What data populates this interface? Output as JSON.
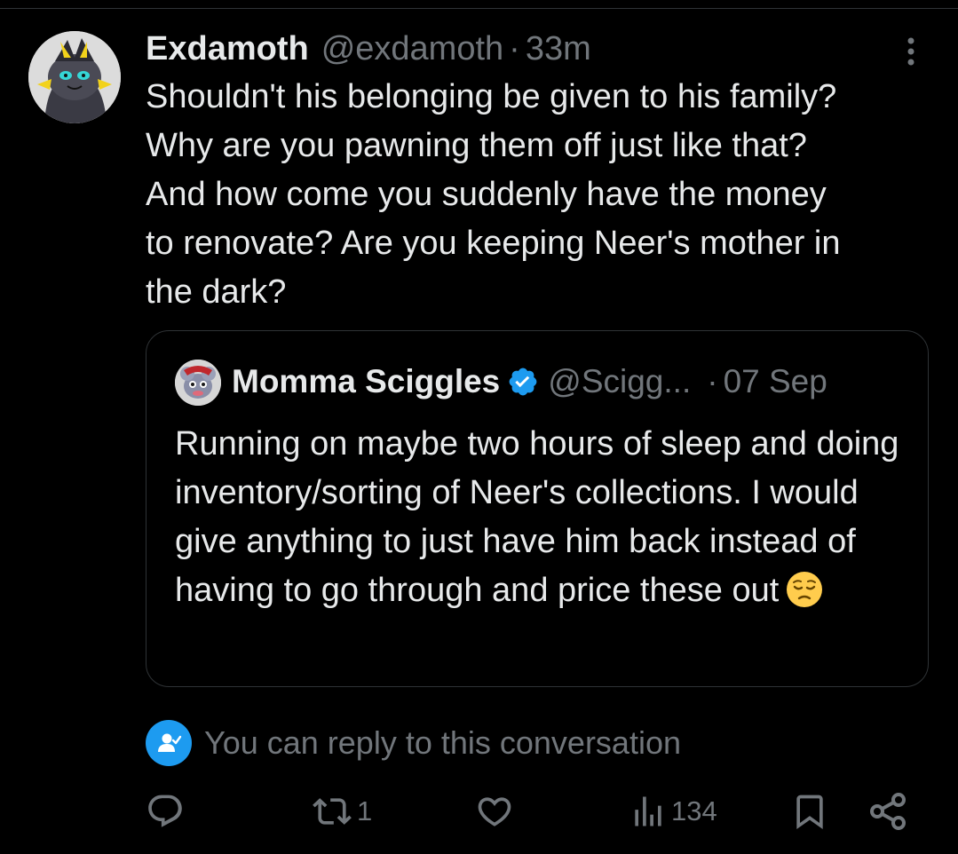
{
  "tweet": {
    "display_name": "Exdamoth",
    "handle": "@exdamoth",
    "separator": "·",
    "time": "33m",
    "text": "Shouldn't his belonging be given to his family?\nWhy are you pawning them off just like that?\nAnd how come you suddenly have the money\nto renovate? Are you keeping Neer's mother in\nthe dark?",
    "avatar_icon": "zeraora-avatar-icon",
    "more_icon": "more-vertical-icon"
  },
  "quote": {
    "display_name": "Momma Sciggles",
    "handle": "@Scigg...",
    "separator": "·",
    "date": "07 Sep",
    "text": "Running on maybe two hours of sleep and doing inventory/sorting of Neer's collections. I would give anything to just have him back instead of having to go through and price these out",
    "emoji": "pensive-face-icon",
    "verified_icon": "verified-badge-icon",
    "verified_color": "#1d9bf0"
  },
  "reply_notice": {
    "text": "You can reply to this conversation",
    "icon": "person-check-icon"
  },
  "actions": {
    "reply_icon": "reply-icon",
    "repost_icon": "repost-icon",
    "repost_count": "1",
    "like_icon": "heart-icon",
    "views_icon": "views-icon",
    "views_count": "134",
    "bookmark_icon": "bookmark-icon",
    "share_icon": "share-icon"
  },
  "colors": {
    "background": "#000000",
    "text_primary": "#e7e9ea",
    "text_secondary": "#71767b",
    "border": "#2f3336",
    "accent": "#1d9bf0"
  }
}
